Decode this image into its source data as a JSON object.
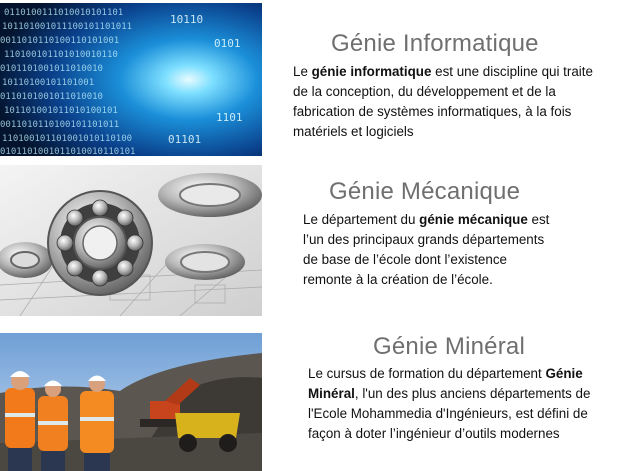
{
  "sections": [
    {
      "title": "Génie Informatique",
      "image": "binary-tunnel-image",
      "text_parts": [
        {
          "text": "Le ",
          "bold": false
        },
        {
          "text": "génie informatique",
          "bold": true
        },
        {
          "text": " est une discipline qui traite de la conception,  du développement  et de la fabrication de systèmes informatiques, à la fois matériels et logiciels",
          "bold": false
        }
      ]
    },
    {
      "title": "Génie Mécanique",
      "image": "ball-bearings-image",
      "text_parts": [
        {
          "text": "Le département du ",
          "bold": false
        },
        {
          "text": "génie mécanique",
          "bold": true
        },
        {
          "text": " est l’un des principaux grands départements de base de l’école dont l’existence remonte à la création de l’école.",
          "bold": false
        }
      ]
    },
    {
      "title": "Génie Minéral",
      "image": "mining-workers-image",
      "text_parts": [
        {
          "text": "Le cursus de formation du département ",
          "bold": false
        },
        {
          "text": "Génie Minéral",
          "bold": true
        },
        {
          "text": ", l'un des plus anciens départements  de l'Ecole Mohammedia d'Ingénieurs, est défini de façon à doter l’ingénieur d’outils modernes",
          "bold": false
        }
      ]
    }
  ]
}
